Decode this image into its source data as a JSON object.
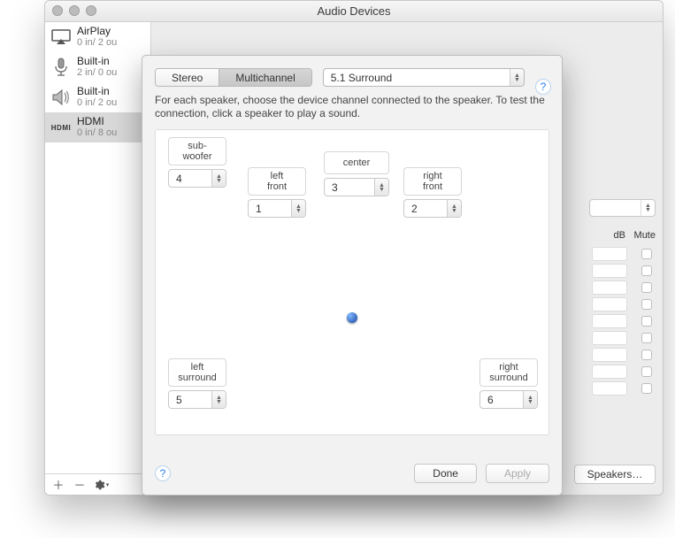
{
  "window": {
    "title": "Audio Devices"
  },
  "sidebar": {
    "items": [
      {
        "name": "AirPlay",
        "sub": "0 in/ 2 ou"
      },
      {
        "name": "Built-in",
        "sub": "2 in/ 0 ou"
      },
      {
        "name": "Built-in",
        "sub": "0 in/ 2 ou"
      },
      {
        "name": "HDMI",
        "sub": "0 in/ 8 ou"
      }
    ]
  },
  "main": {
    "db_header": "dB",
    "mute_header": "Mute",
    "speakers_btn": "Speakers…"
  },
  "sheet": {
    "seg": {
      "stereo": "Stereo",
      "multichannel": "Multichannel"
    },
    "layout_select": "5.1 Surround",
    "instructions": "For each speaker, choose the device channel connected to the speaker. To test the connection, click a speaker to play a sound.",
    "speakers": {
      "subwoofer": {
        "label": "sub-\nwoofer",
        "channel": "4"
      },
      "left_front": {
        "label": "left\nfront",
        "channel": "1"
      },
      "center": {
        "label": "center",
        "channel": "3"
      },
      "right_front": {
        "label": "right\nfront",
        "channel": "2"
      },
      "left_surround": {
        "label": "left\nsurround",
        "channel": "5"
      },
      "right_surround": {
        "label": "right\nsurround",
        "channel": "6"
      }
    },
    "done": "Done",
    "apply": "Apply",
    "help": "?"
  }
}
